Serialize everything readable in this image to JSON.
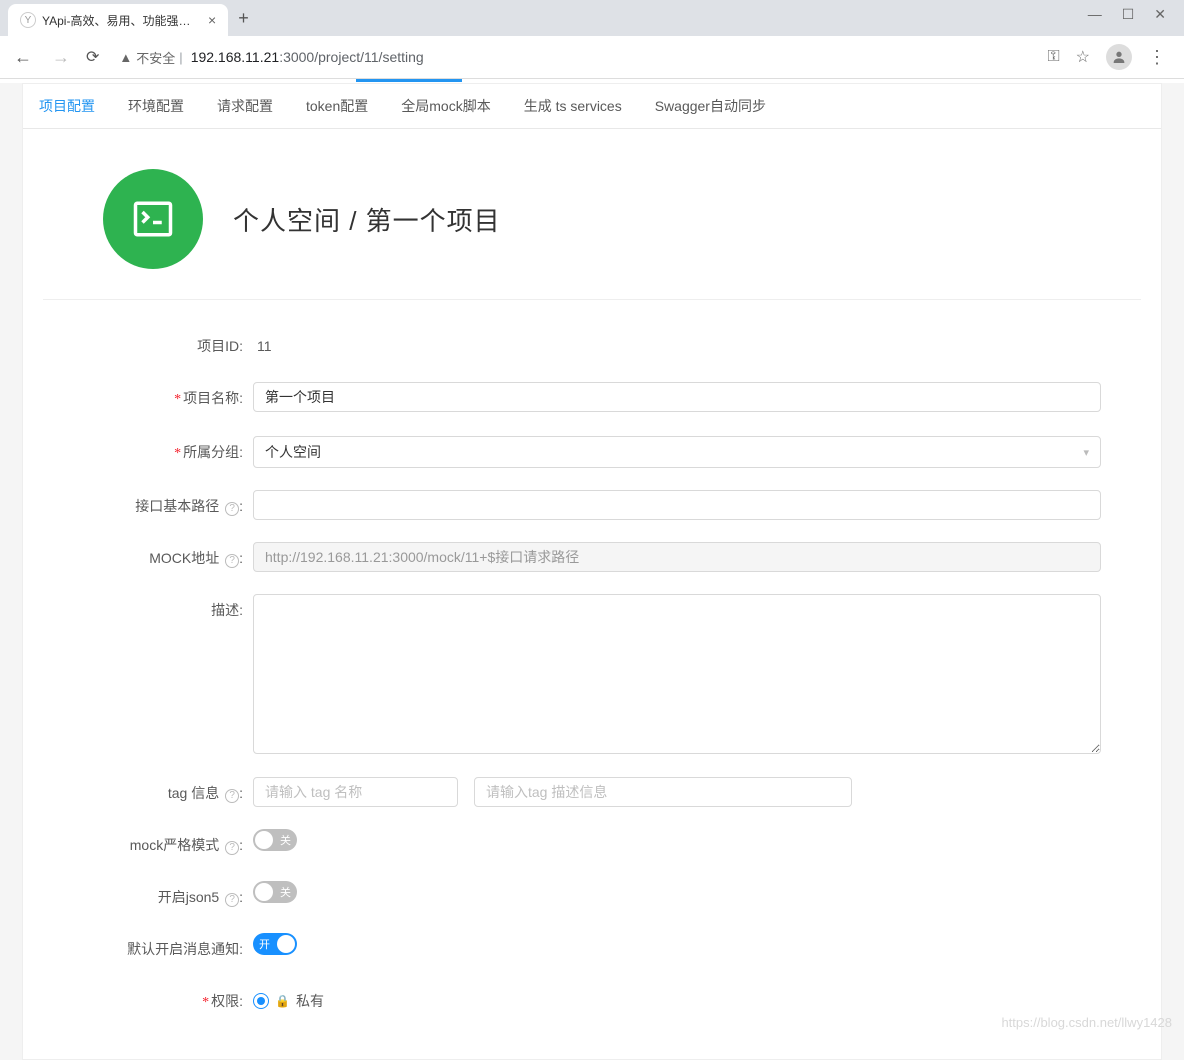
{
  "browser": {
    "tab_title": "YApi-高效、易用、功能强大的可",
    "not_secure_label": "不安全",
    "url_host": "192.168.11.21",
    "url_rest": ":3000/project/11/setting"
  },
  "tabs": [
    {
      "label": "项目配置",
      "active": true
    },
    {
      "label": "环境配置",
      "active": false
    },
    {
      "label": "请求配置",
      "active": false
    },
    {
      "label": "token配置",
      "active": false
    },
    {
      "label": "全局mock脚本",
      "active": false
    },
    {
      "label": "生成 ts services",
      "active": false
    },
    {
      "label": "Swagger自动同步",
      "active": false
    }
  ],
  "breadcrumb": "个人空间 / 第一个项目",
  "form": {
    "project_id_label": "项目ID:",
    "project_id_value": "11",
    "project_name_label": "项目名称:",
    "project_name_value": "第一个项目",
    "group_label": "所属分组:",
    "group_value": "个人空间",
    "basepath_label": "接口基本路径",
    "basepath_value": "",
    "mockurl_label": "MOCK地址",
    "mockurl_value": "http://192.168.11.21:3000/mock/11+$接口请求路径",
    "desc_label": "描述:",
    "desc_value": "",
    "tag_label": "tag 信息",
    "tag_name_placeholder": "请输入 tag 名称",
    "tag_desc_placeholder": "请输入tag 描述信息",
    "mock_strict_label": "mock严格模式",
    "json5_label": "开启json5",
    "notify_label": "默认开启消息通知:",
    "permission_label": "权限:",
    "permission_option_private": "私有",
    "switch_on": "开",
    "switch_off": "关"
  },
  "watermark": "https://blog.csdn.net/llwy1428"
}
